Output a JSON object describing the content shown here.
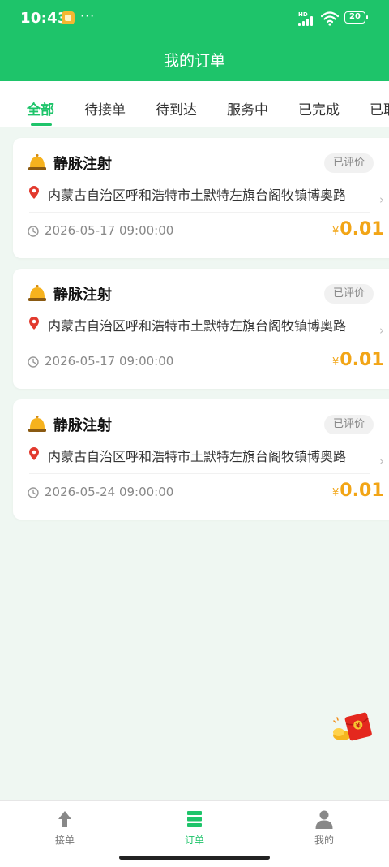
{
  "status_bar": {
    "time": "10:43",
    "more": "···",
    "network": "HD",
    "battery": "20"
  },
  "header": {
    "title": "我的订单"
  },
  "tabs": [
    {
      "label": "全部",
      "active": true
    },
    {
      "label": "待接单",
      "active": false
    },
    {
      "label": "待到达",
      "active": false
    },
    {
      "label": "服务中",
      "active": false
    },
    {
      "label": "已完成",
      "active": false
    },
    {
      "label": "已取",
      "active": false
    }
  ],
  "orders": [
    {
      "service": "静脉注射",
      "status": "已评价",
      "address": "内蒙古自治区呼和浩特市土默特左旗台阁牧镇博奥路",
      "datetime": "2026-05-17 09:00:00",
      "currency": "¥",
      "price": "0.01"
    },
    {
      "service": "静脉注射",
      "status": "已评价",
      "address": "内蒙古自治区呼和浩特市土默特左旗台阁牧镇博奥路",
      "datetime": "2026-05-17 09:00:00",
      "currency": "¥",
      "price": "0.01"
    },
    {
      "service": "静脉注射",
      "status": "已评价",
      "address": "内蒙古自治区呼和浩特市土默特左旗台阁牧镇博奥路",
      "datetime": "2026-05-24 09:00:00",
      "currency": "¥",
      "price": "0.01"
    }
  ],
  "bottom_nav": [
    {
      "label": "接单",
      "icon": "arrow-up-icon",
      "active": false
    },
    {
      "label": "订单",
      "icon": "list-icon",
      "active": true
    },
    {
      "label": "我的",
      "icon": "person-icon",
      "active": false
    }
  ],
  "colors": {
    "brand": "#1ec46a",
    "price": "#f2a516",
    "background": "#eff7f2"
  }
}
